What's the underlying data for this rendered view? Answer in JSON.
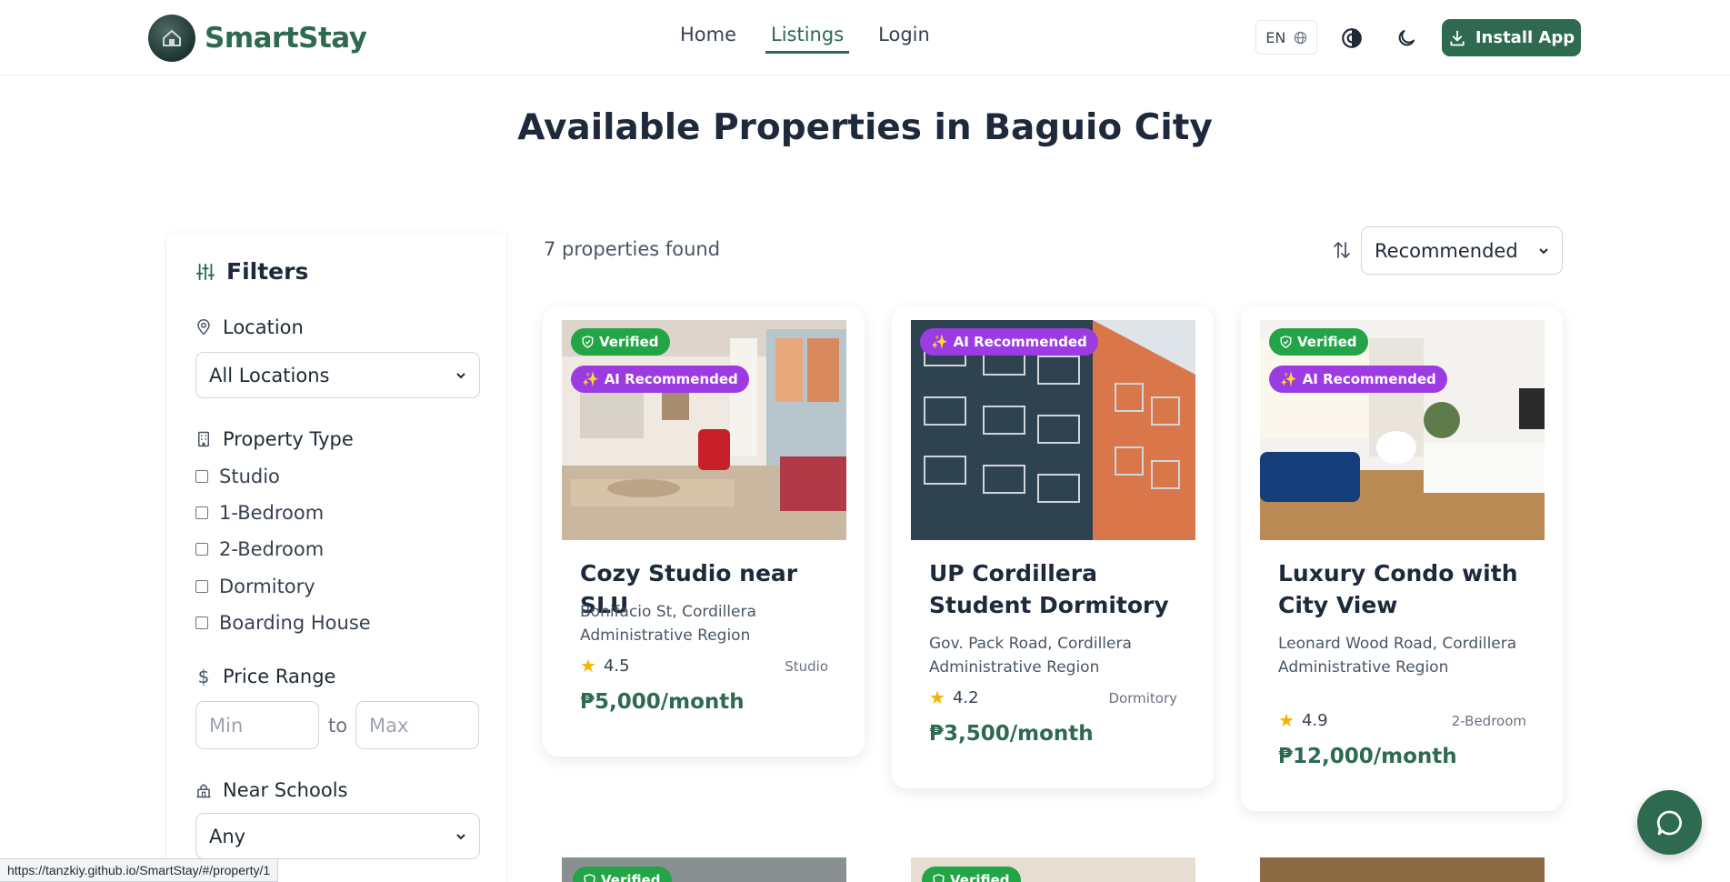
{
  "brand": {
    "name": "SmartStay"
  },
  "nav": {
    "items": [
      "Home",
      "Listings",
      "Login"
    ],
    "active": "Listings"
  },
  "header": {
    "lang": "EN",
    "install_label": "Install App"
  },
  "page": {
    "title": "Available Properties in Baguio City"
  },
  "filters": {
    "heading": "Filters",
    "location": {
      "label": "Location",
      "value": "All Locations"
    },
    "property_type": {
      "label": "Property Type",
      "options": [
        "Studio",
        "1-Bedroom",
        "2-Bedroom",
        "Dormitory",
        "Boarding House"
      ]
    },
    "price": {
      "label": "Price Range",
      "min_placeholder": "Min",
      "to": "to",
      "max_placeholder": "Max"
    },
    "schools": {
      "label": "Near Schools",
      "value": "Any"
    }
  },
  "results": {
    "count_text": "7 properties found",
    "sort_value": "Recommended"
  },
  "badges": {
    "verified": "Verified",
    "ai": "AI Recommended"
  },
  "listings": [
    {
      "title": "Cozy Studio near SLU",
      "location": "Bonifacio St, Cordillera Administrative Region",
      "rating": "4.5",
      "type": "Studio",
      "price": "₱5,000/month",
      "verified": true,
      "ai": true
    },
    {
      "title": "UP Cordillera Student Dormitory",
      "location": "Gov. Pack Road, Cordillera Administrative Region",
      "rating": "4.2",
      "type": "Dormitory",
      "price": "₱3,500/month",
      "verified": false,
      "ai": true
    },
    {
      "title": "Luxury Condo with City View",
      "location": "Leonard Wood Road, Cordillera Administrative Region",
      "rating": "4.9",
      "type": "2-Bedroom",
      "price": "₱12,000/month",
      "verified": true,
      "ai": true
    }
  ],
  "status_bar": {
    "url": "https://tanzkiy.github.io/SmartStay/#/property/1"
  },
  "colors": {
    "brand": "#2d6a4f",
    "verified": "#22a447",
    "ai": "#9d3be3",
    "star": "#f5b301"
  }
}
